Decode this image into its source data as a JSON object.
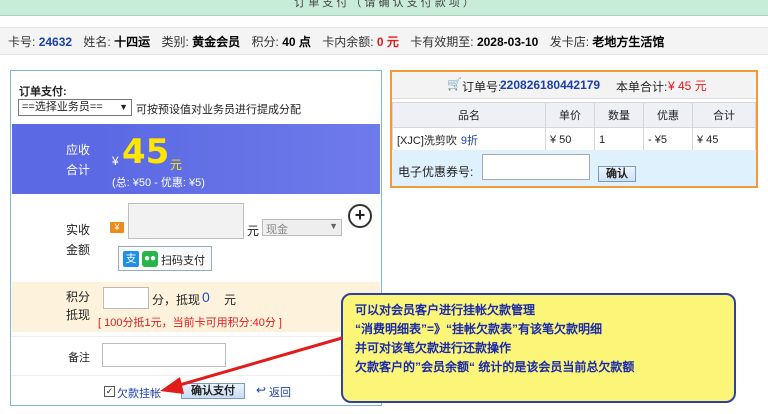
{
  "title": "订 单 支 付 （ 请 确 认 支 付 款 项 ）",
  "member": {
    "card_no_label": "卡号:",
    "card_no": "24632",
    "name_label": "姓名:",
    "name": "十四运",
    "category_label": "类别:",
    "category": "黄金会员",
    "points_label": "积分:",
    "points": "40 点",
    "balance_label": "卡内余额:",
    "balance": "0 元",
    "expiry_label": "卡有效期至:",
    "expiry": "2028-03-10",
    "store_label": "发卡店:",
    "store": "老地方生活馆"
  },
  "payment": {
    "heading": "订单支付:",
    "staff_select": "==选择业务员==",
    "staff_hint": "可按预设值对业务员进行提成分配",
    "due_label_1": "应收",
    "due_label_2": "合计",
    "due_currency": "¥",
    "due_amount": "45",
    "due_unit": "元",
    "due_detail": "(总: ¥50 - 优惠: ¥5)",
    "paid_label_1": "实收",
    "paid_label_2": "金额",
    "cash_icon": "¥",
    "paid_unit": "元",
    "pay_method": "现金",
    "scan_label": "扫码支付",
    "points_label_1": "积分",
    "points_label_2": "抵现",
    "points_unit": "分，抵现",
    "points_amount": "0",
    "points_yuan": "元",
    "points_note": "[ 100分抵1元，当前卡可用积分:40分 ]",
    "remark_label": "备注",
    "credit_label": "欠款挂帐",
    "confirm_label": "确认支付",
    "back_label": "返回"
  },
  "order": {
    "order_no_label": "订单号:",
    "order_no": "220826180442179",
    "total_label": "本单合计:",
    "total": "¥ 45 元",
    "columns": [
      "品名",
      "单价",
      "数量",
      "优惠",
      "合计"
    ],
    "rows": [
      {
        "name": "[XJC]洗剪吹",
        "discount_tag": "9折",
        "price": "¥ 50",
        "qty": "1",
        "discount": "- ¥5",
        "total": "¥ 45"
      }
    ],
    "coupon_label": "电子优惠券号:",
    "coupon_confirm": "确认"
  },
  "callout": {
    "line1": "可以对会员客户进行挂帐欠款管理",
    "line2": "“消费明细表”=》“挂帐欠款表”有该笔欠款明细",
    "line3": "并可对该笔欠款进行还款操作",
    "line4": "欠款客户的”会员余额“ 统计的是该会员当前总欠款额"
  },
  "colors": {
    "accent_blue": "#5b69e4",
    "amount_yellow": "#ffe600",
    "red": "#e21b1b",
    "callout_bg": "#fbf678",
    "arrow": "#e21b1b"
  }
}
